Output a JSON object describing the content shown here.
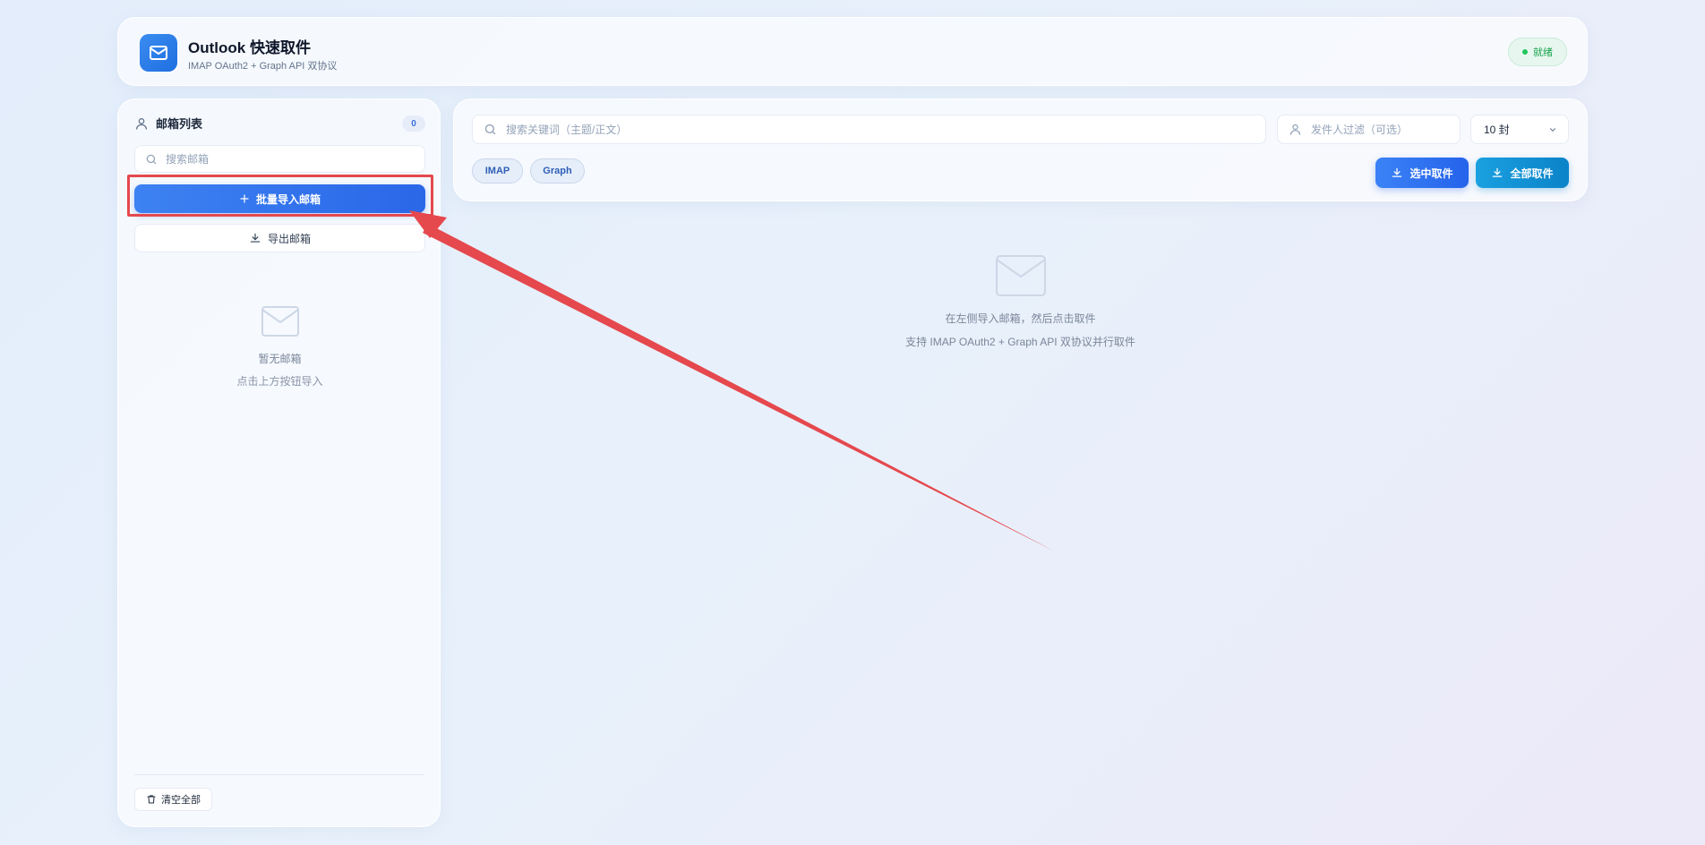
{
  "header": {
    "title": "Outlook 快速取件",
    "subtitle": "IMAP OAuth2 + Graph API 双协议",
    "status": "就绪",
    "status_color": "#16a34a"
  },
  "sidebar": {
    "title": "邮箱列表",
    "count": "0",
    "search_placeholder": "搜索邮箱",
    "import_label": "批量导入邮箱",
    "export_label": "导出邮箱",
    "empty_title": "暂无邮箱",
    "empty_hint": "点击上方按钮导入",
    "clear_label": "清空全部"
  },
  "toolbar": {
    "keyword_placeholder": "搜索关键词（主题/正文）",
    "sender_placeholder": "发件人过滤（可选）",
    "count_select": "10 封",
    "chips": [
      "IMAP",
      "Graph"
    ],
    "fetch_selected_label": "选中取件",
    "fetch_all_label": "全部取件"
  },
  "main": {
    "empty_line1": "在左侧导入邮箱，然后点击取件",
    "empty_line2": "支持 IMAP OAuth2 + Graph API 双协议并行取件"
  },
  "colors": {
    "primary": "#2a67e8",
    "secondary": "#0b83c9",
    "annotation": "#e5484d"
  }
}
